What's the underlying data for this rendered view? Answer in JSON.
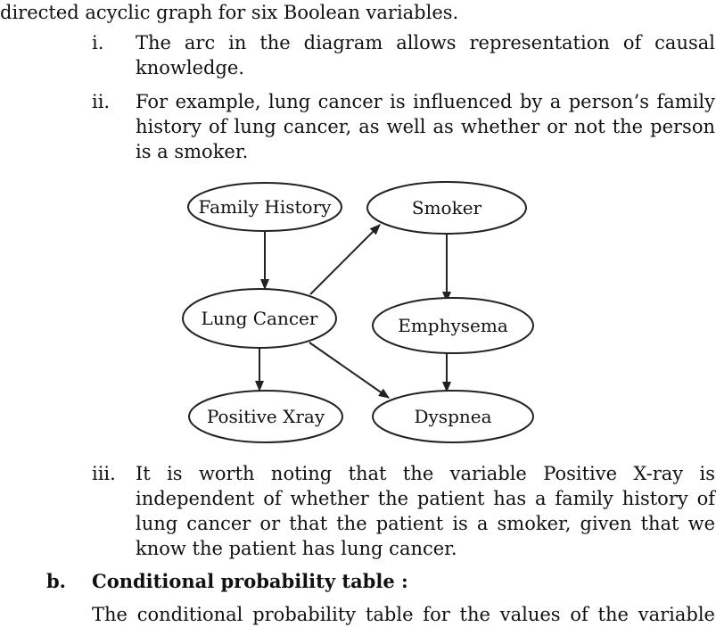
{
  "intro_line": "directed acyclic graph for six Boolean variables.",
  "items": [
    {
      "num": "i.",
      "text": "The arc in the diagram allows representation of causal knowledge."
    },
    {
      "num": "ii.",
      "text": "For example, lung cancer is influenced by a person’s family history of lung cancer, as well as whether or not the person is a smoker."
    },
    {
      "num": "iii.",
      "text": "It is worth noting that the variable Positive X-ray is independent of whether the patient has a family history of lung cancer or that the patient is a smoker, given that we know the patient has lung cancer."
    }
  ],
  "diagram": {
    "nodes": {
      "family_history": "Family History",
      "smoker": "Smoker",
      "lung_cancer": "Lung Cancer",
      "emphysema": "Emphysema",
      "positive_xray": "Positive Xray",
      "dyspnea": "Dyspnea"
    },
    "edges": [
      [
        "Family History",
        "Lung Cancer"
      ],
      [
        "Lung Cancer",
        "Smoker"
      ],
      [
        "Smoker",
        "Emphysema"
      ],
      [
        "Lung Cancer",
        "Positive Xray"
      ],
      [
        "Lung Cancer",
        "Dyspnea"
      ],
      [
        "Emphysema",
        "Dyspnea"
      ]
    ]
  },
  "section_b": {
    "label": "b.",
    "title": "Conditional probability table :",
    "text_start": "The conditional probability table for the values of the variable"
  }
}
